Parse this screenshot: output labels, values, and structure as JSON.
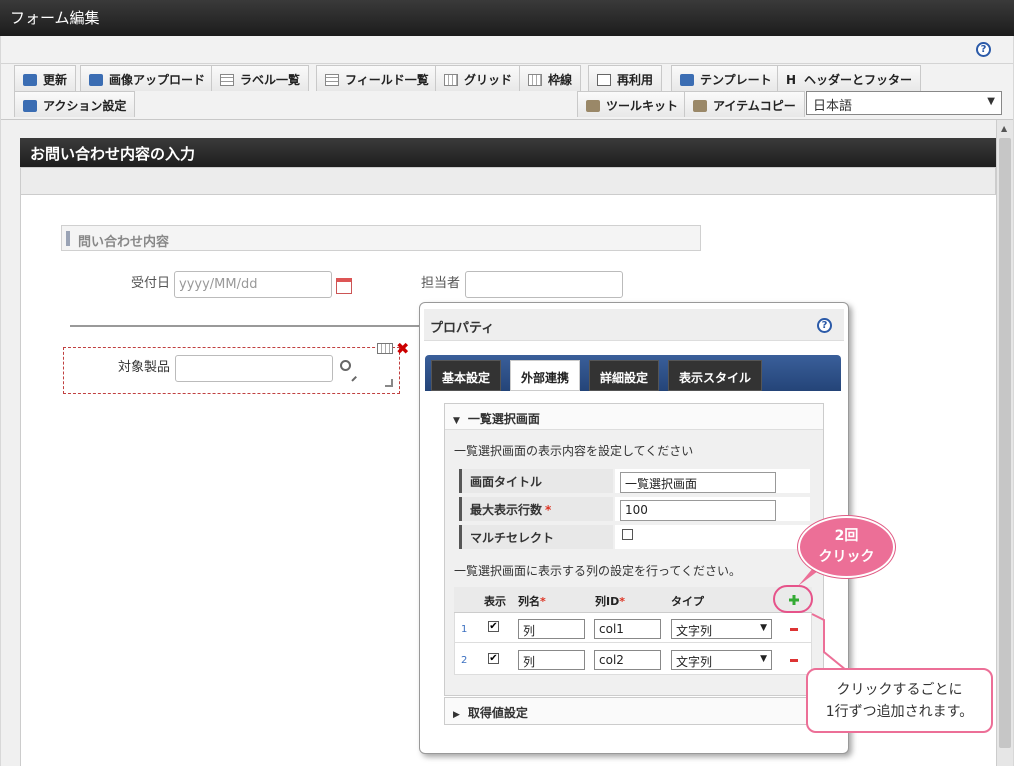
{
  "window": {
    "title": "フォーム編集"
  },
  "toolbar": {
    "update": "更新",
    "image_upload": "画像アップロード",
    "label_list": "ラベル一覧",
    "field_list": "フィールド一覧",
    "grid": "グリッド",
    "border": "枠線",
    "reuse": "再利用",
    "template": "テンプレート",
    "header_footer_icon": "H",
    "header_footer": "ヘッダーとフッター",
    "action_settings": "アクション設定",
    "toolkit": "ツールキット",
    "item_copy": "アイテムコピー",
    "language": "日本語"
  },
  "help_label": "?",
  "form": {
    "title": "お問い合わせ内容の入力",
    "section_title": "問い合わせ内容",
    "received_date_label": "受付日",
    "received_date_placeholder": "yyyy/MM/dd",
    "assignee_label": "担当者",
    "target_product_label": "対象製品"
  },
  "properties": {
    "title": "プロパティ",
    "tabs": [
      "基本設定",
      "外部連携",
      "詳細設定",
      "表示スタイル"
    ],
    "active_tab": "外部連携",
    "list_screen": {
      "header": "一覧選択画面",
      "description": "一覧選択画面の表示内容を設定してください",
      "screen_title_label": "画面タイトル",
      "screen_title_value": "一覧選択画面",
      "max_rows_label": "最大表示行数",
      "max_rows_value": "100",
      "multi_select_label": "マルチセレクト",
      "column_description": "一覧選択画面に表示する列の設定を行ってください。",
      "columns_header": {
        "show": "表示",
        "name": "列名",
        "id": "列ID",
        "type": "タイプ"
      },
      "required_mark": "*",
      "rows": [
        {
          "num": "1",
          "show": "✔",
          "name": "列",
          "id": "col1",
          "type": "文字列"
        },
        {
          "num": "2",
          "show": "✔",
          "name": "列",
          "id": "col2",
          "type": "文字列"
        }
      ]
    },
    "get_value_header": "取得値設定"
  },
  "callouts": {
    "click_twice_line1": "2回",
    "click_twice_line2": "クリック",
    "adds_row_line1": "クリックするごとに",
    "adds_row_line2": "1行ずつ追加されます。"
  },
  "colors": {
    "accent": "#ec6f97",
    "tab_bar": "#2d4f8a",
    "title_bar": "#2a2a2a"
  }
}
